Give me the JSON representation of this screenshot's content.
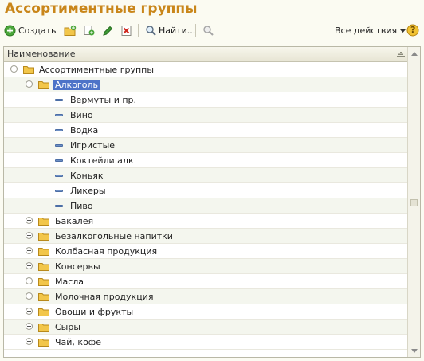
{
  "window": {
    "title": "Ассортиментные группы"
  },
  "toolbar": {
    "create_label": "Создать",
    "find_label": "Найти...",
    "all_actions_label": "Все действия",
    "help_label": "?"
  },
  "grid": {
    "column_header": "Наименование"
  },
  "tree": {
    "root": "Ассортиментные группы",
    "selected": "Алкоголь",
    "children_of_selected": [
      "Вермуты и пр.",
      "Вино",
      "Водка",
      "Игристые",
      "Коктейли алк",
      "Коньяк",
      "Ликеры",
      "Пиво"
    ],
    "groups": [
      "Бакалея",
      "Безалкогольные напитки",
      "Колбасная продукция",
      "Консервы",
      "Масла",
      "Молочная продукция",
      "Овощи и фрукты",
      "Сыры",
      "Чай, кофе"
    ]
  },
  "colors": {
    "title": "#c9861a",
    "selection": "#4d73c8",
    "folder": "#f2c64a"
  }
}
